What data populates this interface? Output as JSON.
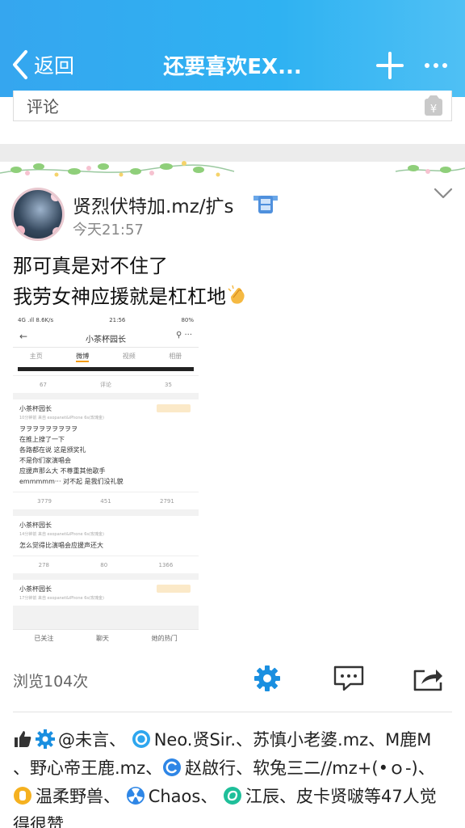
{
  "header": {
    "back_label": "返回",
    "title": "还要喜欢EX..."
  },
  "comment": {
    "placeholder": "评论"
  },
  "post": {
    "username": "贤烈伏特加.mz/扩s",
    "time": "今天21:57",
    "lines": [
      "那可真是对不住了",
      "我劳女神应援就是杠杠地"
    ],
    "embedded_screenshot": {
      "status_left": "4G .ıll 8.6K/s",
      "status_time": "21:56",
      "status_right": "80%",
      "nav_title": "小茶杯园长",
      "tabs": [
        "主页",
        "微博",
        "视频",
        "相册"
      ],
      "top_actions": [
        "67",
        "评论",
        "35"
      ],
      "card1": {
        "name": "小茶杯园长",
        "sub": "10分钟前 来自 exopanet&iPhone 6s(玫瑰金)",
        "lines": [
          "ヲヲヲヲヲヲヲヲヲ",
          "在推上搜了一下",
          "各路都在说 这是颁奖礼",
          "不是你们家演唱会",
          "应援声那么大 不尊重其他歌手",
          "emmmmm··· 对不起 是我们没礼貌"
        ],
        "actions": [
          "3779",
          "451",
          "2791"
        ]
      },
      "card2": {
        "name": "小茶杯园长",
        "sub": "14分钟前 来自 exopanet&iPhone 6s(玫瑰金)",
        "lines": [
          "怎么觉得比演唱会应援声还大"
        ],
        "actions": [
          "278",
          "80",
          "1366"
        ]
      },
      "card3": {
        "name": "小茶杯园长",
        "sub": "17分钟前 来自 exopanet&iPhone 6s(玫瑰金)"
      },
      "bottom_bar": [
        "已关注",
        "聊天",
        "她的热门"
      ]
    },
    "views": "浏览104次"
  },
  "likes": {
    "row1_a": "@未言、",
    "row1_b": "Neo.贤Sir.、苏慎小老婆.mz、M鹿M",
    "row2_a": "、野心帝王鹿.mz、",
    "row2_b": "赵啟行、软兔三二//mz+(•ｏ-)、",
    "row3_a": "温柔野兽、",
    "row3_b": "Chaos、",
    "row3_c": "江辰、皮卡贤啵等47人觉",
    "row4": "得很赞"
  },
  "colors": {
    "header_bg": "#35a6ef",
    "accent_blue": "#1a8fe0",
    "separator": "#ececec"
  }
}
